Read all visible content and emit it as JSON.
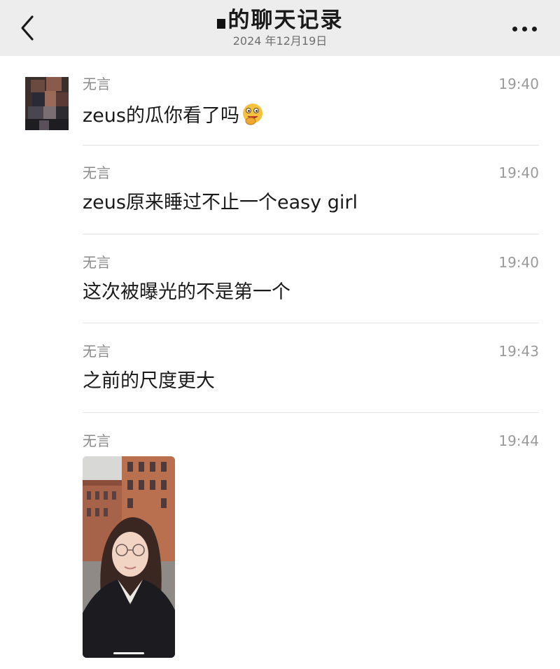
{
  "header": {
    "title": "的聊天记录",
    "subtitle": "2024 年12月19日"
  },
  "messages": [
    {
      "sender": "无言",
      "time": "19:40",
      "text": "zeus的瓜你看了吗",
      "emoji": "grinning-face-with-hand-icon"
    },
    {
      "sender": "无言",
      "time": "19:40",
      "text": "zeus原来睡过不止一个easy girl"
    },
    {
      "sender": "无言",
      "time": "19:40",
      "text": "这次被曝光的不是第一个"
    },
    {
      "sender": "无言",
      "time": "19:43",
      "text": "之前的尺度更大"
    },
    {
      "sender": "无言",
      "time": "19:44",
      "image": "selfie-photo"
    }
  ],
  "colors": {
    "header_bg": "#ededed",
    "separator": "#e2e2e2",
    "meta_text": "#8a8a8a"
  }
}
